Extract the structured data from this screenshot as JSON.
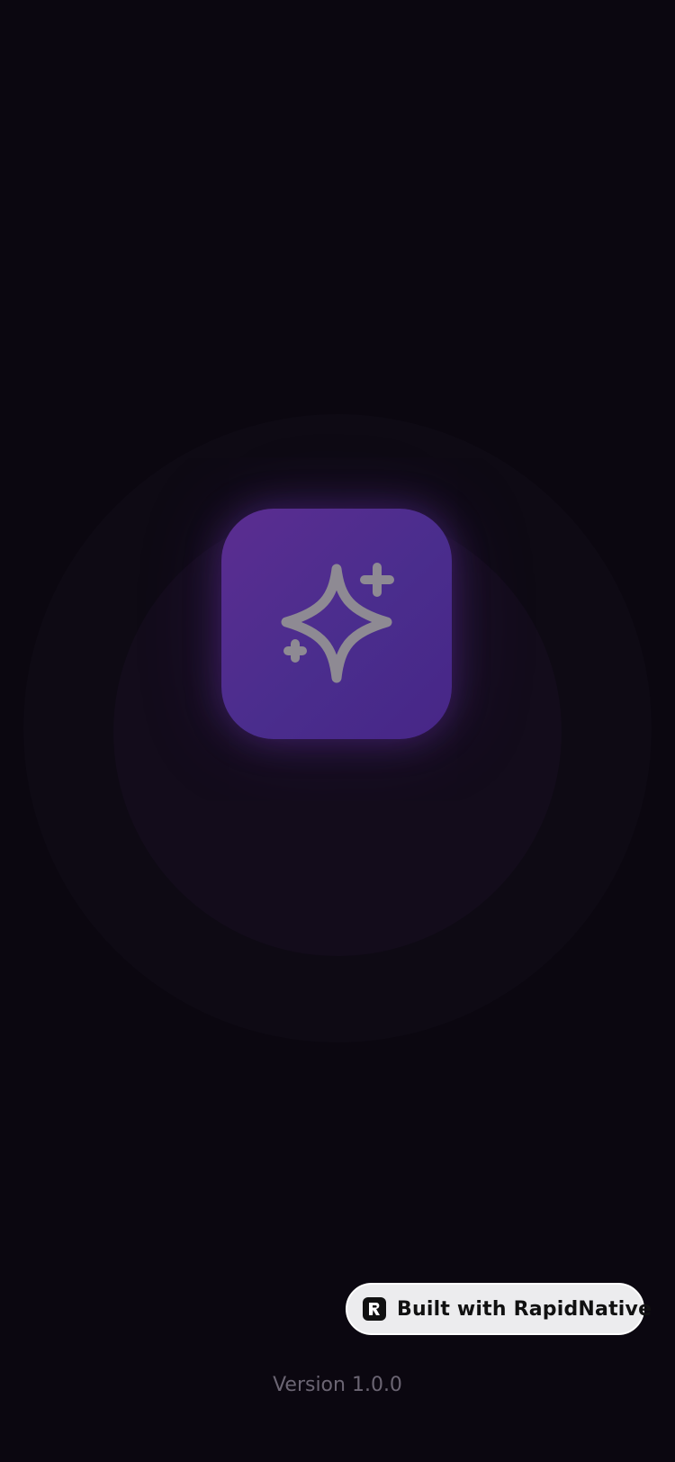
{
  "app": {
    "icon": "sparkles-icon",
    "accent_color": "#4f2b8f",
    "background_color": "#0b0710"
  },
  "badge": {
    "label": "Built with RapidNative",
    "logo": "rapidnative-logo"
  },
  "footer": {
    "version": "Version 1.0.0"
  }
}
